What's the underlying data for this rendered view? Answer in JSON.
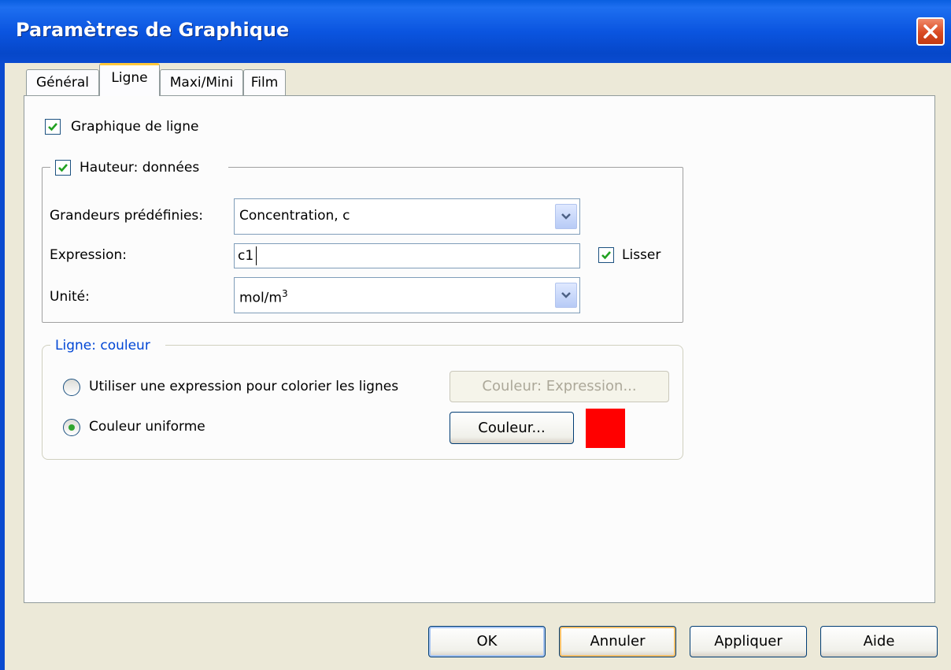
{
  "window": {
    "title": "Paramètres de Graphique"
  },
  "tabs": [
    {
      "label": "Général"
    },
    {
      "label": "Ligne"
    },
    {
      "label": "Maxi/Mini"
    },
    {
      "label": "Film"
    }
  ],
  "line_plot": {
    "label": "Graphique de ligne",
    "checked": true
  },
  "height_data": {
    "label": "Hauteur: données",
    "checked": true,
    "predefined": {
      "label": "Grandeurs prédéfinies:",
      "value": "Concentration, c"
    },
    "expression": {
      "label": "Expression:",
      "value": "c1"
    },
    "smooth": {
      "label": "Lisser",
      "checked": true
    },
    "unit": {
      "label": "Unité:",
      "value_base": "mol/m",
      "value_sup": "3"
    }
  },
  "line_color": {
    "title": "Ligne: couleur",
    "option_expression": {
      "label": "Utiliser une expression pour colorier les lignes",
      "selected": false
    },
    "expression_button": "Couleur: Expression...",
    "option_uniform": {
      "label": "Couleur uniforme",
      "selected": true
    },
    "color_button": "Couleur...",
    "swatch_color": "#ff0000"
  },
  "buttons": {
    "ok": "OK",
    "cancel": "Annuler",
    "apply": "Appliquer",
    "help": "Aide"
  },
  "colors": {
    "title_bar": "#0a55e0",
    "dialog_bg": "#ece9d8",
    "accent_blue": "#0046d5"
  }
}
